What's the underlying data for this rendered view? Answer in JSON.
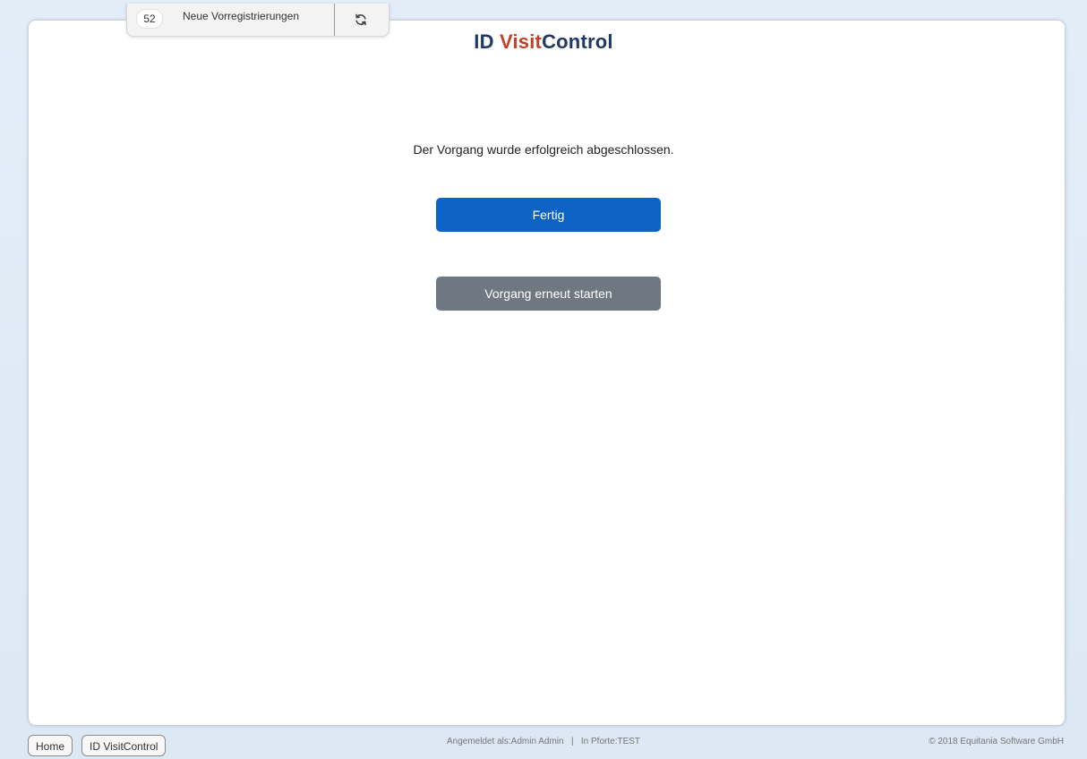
{
  "top_tab": {
    "count": "52",
    "label": "Neue Vorregistrierungen",
    "refresh_icon": "refresh-icon"
  },
  "logo": {
    "part1": "ID ",
    "part2": "Visit",
    "part3": "Control"
  },
  "main": {
    "message": "Der Vorgang wurde erfolgreich abgeschlossen.",
    "primary_button": "Fertig",
    "secondary_button": "Vorgang erneut starten"
  },
  "footer": {
    "home_button": "Home",
    "app_button": "ID VisitControl",
    "logged_in": "Angemeldet als:Admin Admin",
    "separator": "|",
    "gate": "In Pforte:TEST",
    "copyright": "© 2018 Equitania Software GmbH"
  },
  "colors": {
    "primary": "#0d63c4",
    "secondary": "#6f7780",
    "logo_dark": "#1e3a63",
    "logo_accent": "#c0422a"
  }
}
